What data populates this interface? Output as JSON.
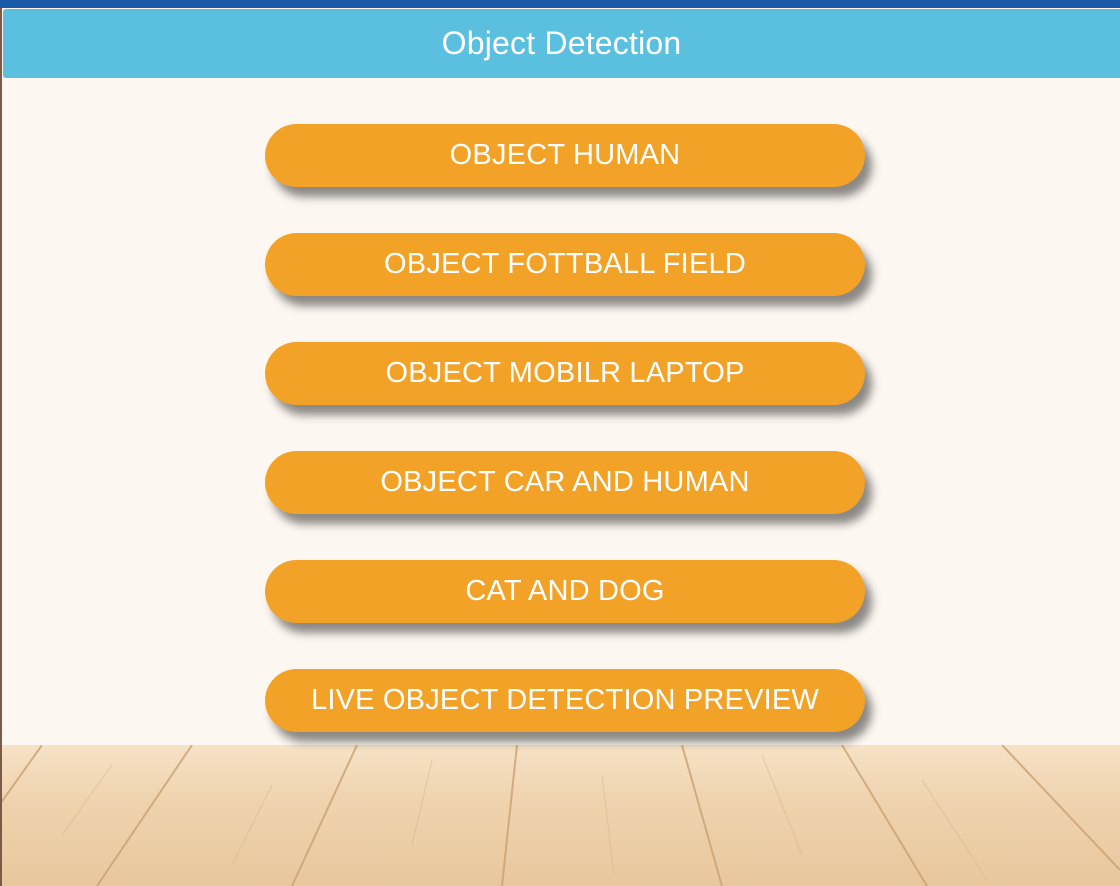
{
  "header": {
    "title": "Object Detection"
  },
  "buttons": [
    {
      "label": "OBJECT HUMAN"
    },
    {
      "label": "OBJECT FOTTBALL FIELD"
    },
    {
      "label": "OBJECT MOBILR LAPTOP"
    },
    {
      "label": "OBJECT CAR AND HUMAN"
    },
    {
      "label": "CAT AND DOG"
    },
    {
      "label": "LIVE OBJECT DETECTION PREVIEW"
    }
  ],
  "colors": {
    "header_bg": "#5bc0e0",
    "top_strip": "#1a5aa8",
    "button_bg": "#f3a228",
    "button_text": "#ffffff",
    "wall_bg": "#fdf7f1",
    "floor_bg": "#efd3ae"
  }
}
